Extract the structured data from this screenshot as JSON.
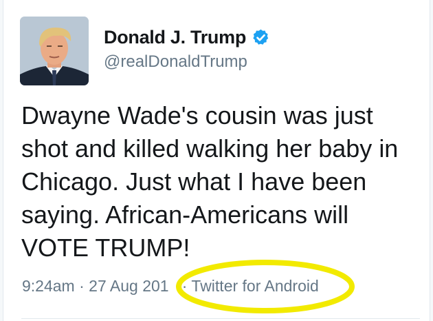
{
  "author": {
    "display_name": "Donald J. Trump",
    "handle": "@realDonaldTrump",
    "verified": true,
    "avatar": "profile-photo"
  },
  "tweet": {
    "text": "Dwayne Wade's cousin was just\nshot and killed walking her baby in\nChicago. Just what I have been\nsaying. African-Americans will\nVOTE TRUMP!"
  },
  "meta": {
    "time": "9:24am",
    "date": "27 Aug 201",
    "separator": "·",
    "source": "Twitter for Android"
  },
  "colors": {
    "verified_badge": "#1da1f2",
    "annotation_circle": "#f2ea00",
    "secondary_text": "#657786"
  },
  "annotation": {
    "shape": "yellow-ellipse",
    "highlights": "meta.source"
  }
}
